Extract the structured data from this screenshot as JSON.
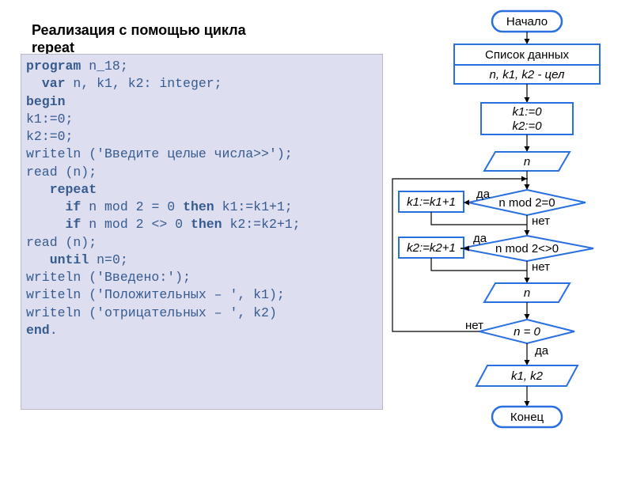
{
  "title": "Реализация с помощью цикла repeat",
  "code": {
    "l1a": "program",
    "l1b": " n_18;",
    "l2a": "var",
    "l2b": " n, k1, k2: integer;",
    "l3": "begin",
    "l4": "   k1:=0;",
    "l5": "   k2:=0;",
    "l6": "   writeln ('Введите целые числа>>');",
    "l7": "   read (n);",
    "l8": "repeat",
    "l9a": "if",
    "l9b": " n mod 2 = 0 ",
    "l9c": "then",
    "l9d": " k1:=k1+1;",
    "l10a": "if",
    "l10b": " n mod 2 <> 0 ",
    "l10c": "then",
    "l10d": " k2:=k2+1;",
    "l11": "     read (n);",
    "l12a": "until",
    "l12b": " n=0;",
    "l13": "   writeln ('Введено:');",
    "l14": "   writeln ('Положительных – ', k1);",
    "l15": "   writeln ('отрицательных – ', k2)",
    "l16": "end",
    "l16b": "."
  },
  "flowchart": {
    "start": "Начало",
    "datalist": "Список данных",
    "vars": "n, k1, k2 - цел",
    "init1": "k1:=0",
    "init2": "k2:=0",
    "input": "n",
    "cond1": "n mod 2=0",
    "act1": "k1:=k1+1",
    "cond2": "n mod 2<>0",
    "act2": "k2:=k2+1",
    "input2": "n",
    "cond3": "n = 0",
    "output": "k1, k2",
    "end": "Конец",
    "yes": "да",
    "no": "нет"
  }
}
